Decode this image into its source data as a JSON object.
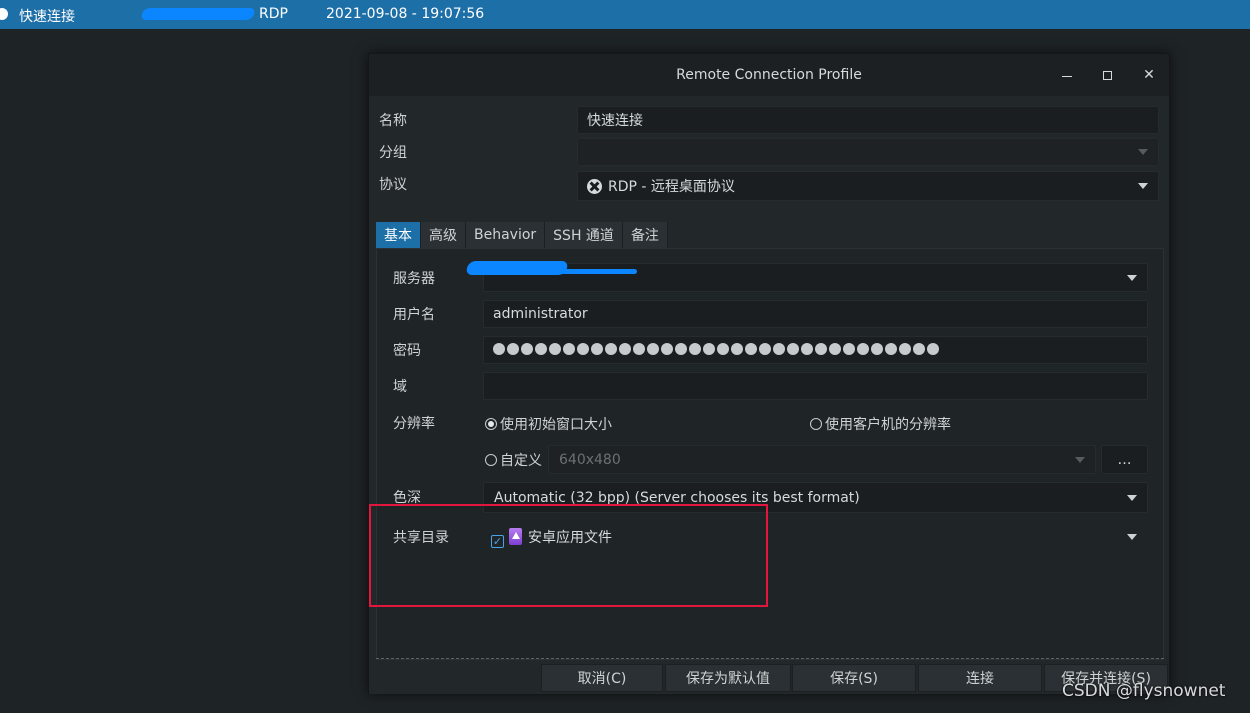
{
  "list_row": {
    "name": "快速连接",
    "protocol": "RDP",
    "timestamp": "2021-09-08 - 19:07:56"
  },
  "dialog": {
    "title": "Remote Connection Profile",
    "name_label": "名称",
    "name_value": "快速连接",
    "group_label": "分组",
    "group_value": "",
    "protocol_label": "协议",
    "protocol_value": "RDP - 远程桌面协议",
    "tabs": [
      "基本",
      "高级",
      "Behavior",
      "SSH 通道",
      "备注"
    ],
    "active_tab": "基本",
    "basic": {
      "server_label": "服务器",
      "user_label": "用户名",
      "user_value": "administrator",
      "password_label": "密码",
      "password_dot_count": 32,
      "domain_label": "域",
      "domain_value": "",
      "resolution_label": "分辨率",
      "res_opt_initial": "使用初始窗口大小",
      "res_opt_client": "使用客户机的分辨率",
      "res_opt_custom": "自定义",
      "custom_resolution": "640x480",
      "more_button": "…",
      "color_depth_label": "色深",
      "color_depth_value": "Automatic (32 bpp) (Server chooses its best format)",
      "share_folder_label": "共享目录",
      "share_folder_checked": true,
      "share_folder_value": "安卓应用文件"
    },
    "buttons": {
      "cancel": "取消(C)",
      "save_default": "保存为默认值",
      "save": "保存(S)",
      "connect": "连接",
      "save_connect": "保存并连接(S)"
    }
  },
  "watermark": "CSDN @flysnownet",
  "colors": {
    "selection": "#1d6fa8",
    "highlight_box": "#e3173e",
    "redaction": "#0b86ff"
  }
}
